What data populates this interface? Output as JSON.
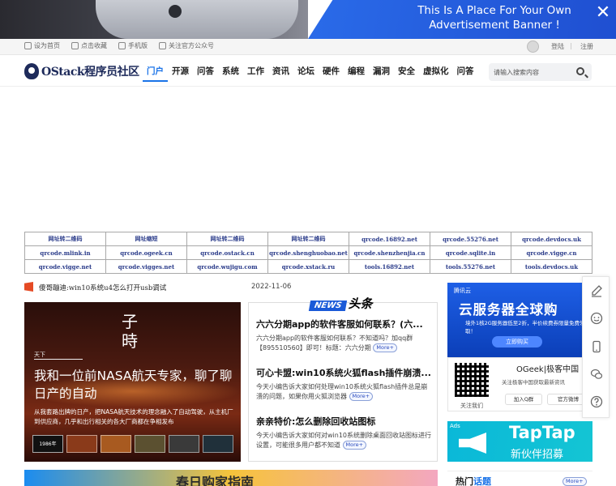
{
  "ad_banner": {
    "line1": "This Is A Place For Your Own",
    "line2": "Advertisement Banner !"
  },
  "topbar": {
    "links": [
      "设为首页",
      "点击收藏",
      "手机版",
      "关注官方公众号"
    ],
    "login": "登陆",
    "separator": "|",
    "register": "注册"
  },
  "header": {
    "logo_text": "OStack程序员社区",
    "nav": [
      "门户",
      "开源",
      "问答",
      "系统",
      "工作",
      "资讯",
      "论坛",
      "硬件",
      "编程",
      "漏洞",
      "安全",
      "虚拟化",
      "问答"
    ],
    "active_index": 0,
    "search_placeholder": "请输入搜索内容"
  },
  "link_table": [
    [
      "网址转二维码",
      "网址缩短",
      "网址转二维码",
      "网址转二维码",
      "qrcode.16892.net",
      "qrcode.55276.net",
      "qrcode.devdocs.uk"
    ],
    [
      "qrcode.mlink.in",
      "qrcode.ogeek.cn",
      "qrcode.ostack.cn",
      "qrcode.shenghuobao.net",
      "qrcode.shenzhenjia.cn",
      "qrcode.sqlite.in",
      "qrcode.vigge.cn"
    ],
    [
      "qrcode.vigge.net",
      "qrcode.vigges.net",
      "qrcode.wujigu.com",
      "qrcode.xstack.ru",
      "tools.16892.net",
      "tools.55276.net",
      "tools.devdocs.uk"
    ]
  ],
  "headline": {
    "text": "傻哥蹦迪:win10系统u4怎么打开usb调试",
    "date": "2022-11-06"
  },
  "feature": {
    "char": "子\n時",
    "tag": "天下",
    "title": "我和一位前NASA航天专家，聊了聊日产的自动",
    "desc": "从我套路出牌的日产，把NASA航天技术的理念融入了自动驾驶，从主机厂到供应商，几乎和出行相关的各大厂商都在争相发布",
    "thumb_label": "1986年"
  },
  "news": {
    "badge": "NEWS",
    "badge2": "头条",
    "items": [
      {
        "title": "六六分期app的软件客服如何联系？(六...",
        "desc": "六六分期app的软件客服如何联系？不知道吗？加qq群【895510560】即可！标题：六六分期",
        "more": "More+"
      },
      {
        "title": "可心卡盟:win10系统火狐flash插件崩溃...",
        "desc": "今天小编告诉大家如何处理win10系统火狐flash插件总是崩溃的问题，如果你用火狐浏览器",
        "more": "More+"
      },
      {
        "title": "亲亲特价:怎么删除回收站图标",
        "desc": "今天小编告诉大家如何对win10系统删除桌面回收站图标进行设置，可能很多用户都不知道",
        "more": "More+"
      }
    ]
  },
  "cloud_ad": {
    "brand": "腾讯云",
    "title": "云服务器全球购",
    "sub": "境外1核2G服务器低至2折，半价续费券限量免费领取！",
    "button": "立即购买"
  },
  "ogeek": {
    "title": "OGeek|极客中国",
    "desc": "关注极客中国获取最新资讯",
    "qr_label": "关注我们",
    "btn_qq": "加入Q群",
    "btn_weibo": "官方微博"
  },
  "taptap": {
    "ads": "Ads",
    "title": "TapTap",
    "sub": "新伙伴招募"
  },
  "side_tools": [
    "edit-icon",
    "chat-icon",
    "mobile-icon",
    "wechat-icon",
    "help-icon"
  ],
  "bottom": {
    "ad_text": "春日购家指南",
    "hot_prefix": "热门",
    "hot_title": "话题",
    "more": "More+"
  }
}
